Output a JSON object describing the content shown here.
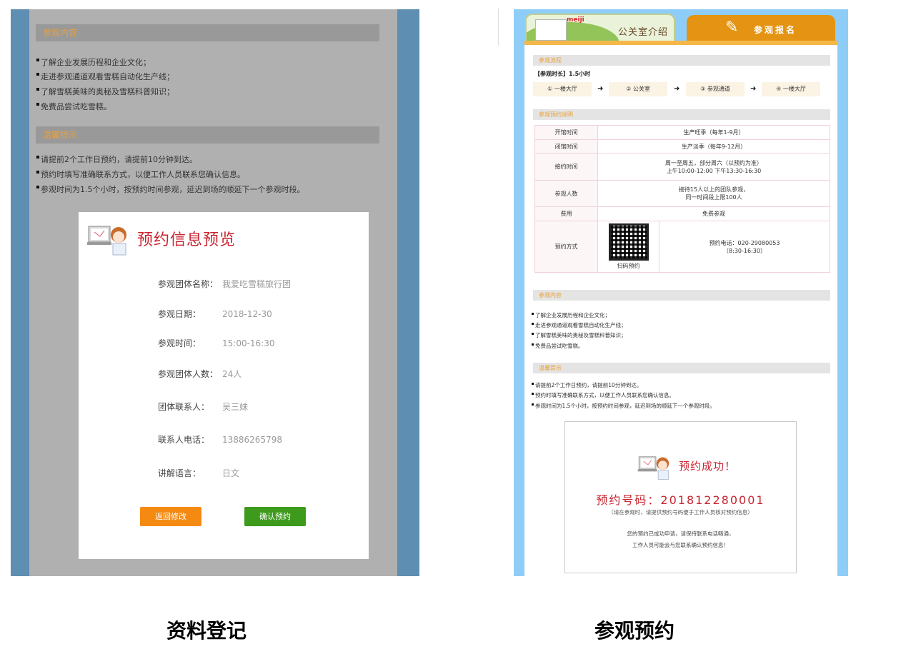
{
  "left": {
    "section_content": "参观内容",
    "content_items": [
      "了解企业发展历程和企业文化；",
      "走进参观通道观看雪糕自动化生产线；",
      "了解雪糕美味的奥秘及雪糕科普知识；",
      "免费品尝试吃雪糕。"
    ],
    "section_tips": "温馨提示",
    "tips_items": [
      "请提前2个工作日预约，请提前10分钟到达。",
      "预约时填写准确联系方式，以便工作人员联系您确认信息。",
      "参观时间为1.5个小时，按预约时间参观，延迟到场的顺延下一个参观时段。"
    ],
    "modal": {
      "title": "预约信息预览",
      "fields": [
        {
          "label": "参观团体名称：",
          "value": "我爱吃雪糕旅行团"
        },
        {
          "label": "参观日期：",
          "value": "2018-12-30"
        },
        {
          "label": "参观时间：",
          "value": "15:00-16:30"
        },
        {
          "label": "参观团体人数：",
          "value": "24人"
        },
        {
          "label": "团体联系人：",
          "value": "吴三妹"
        },
        {
          "label": "联系人电话：",
          "value": "13886265798"
        },
        {
          "label": "讲解语言：",
          "value": "日文"
        }
      ],
      "back_label": "返回修改",
      "confirm_label": "确认预约"
    }
  },
  "right": {
    "tab_intro": "公关室介绍",
    "tab_intro_brand": "meiji",
    "tab_signup": "参观报名",
    "section_flow": "参观流程",
    "duration": "【参观时长】1.5小时",
    "steps": [
      "① 一楼大厅",
      "② 公关室",
      "③ 参观通道",
      "④ 一楼大厅"
    ],
    "section_notes": "参观预约说明",
    "table": [
      {
        "k": "开馆时间",
        "v": "生产旺季（每年1-9月）"
      },
      {
        "k": "闭馆时间",
        "v": "生产淡季（每年9-12月）"
      },
      {
        "k": "接约时间",
        "v": "周一至周五，部分周六（以预约为准）",
        "v2": "上午10:00-12:00  下午13:30-16:30"
      },
      {
        "k": "参观人数",
        "v": "接待15人以上的团队参观，",
        "v2": "同一时间段上限100人"
      },
      {
        "k": "费用",
        "v": "免费参观"
      },
      {
        "k": "预约方式",
        "qr_caption": "扫码预约",
        "v": "预约电话：020-29080053",
        "v2": "（8:30-16:30）"
      }
    ],
    "section_content": "参观内容",
    "content_items": [
      "了解企业发展历程和企业文化；",
      "走进参观通道观看雪糕自动化生产线；",
      "了解雪糕美味的奥秘及雪糕科普知识；",
      "免费品尝试吃雪糕。"
    ],
    "section_tips": "温馨提示",
    "tips_items": [
      "请提前2个工作日预约，请提前10分钟到达。",
      "预约时填写准确联系方式，以便工作人员联系您确认信息。",
      "参观时间为1.5个小时，按预约时间参观，延迟到场的顺延下一个参观时段。"
    ],
    "success": {
      "title": "预约成功！",
      "code": "预约号码：201812280001",
      "hint": "（请在参观时，请提供预约号码便于工作人员核对预约信息）",
      "msg1": "您的预约已成功申请，请保持联系电话畅通，",
      "msg2": "工作人员可能会与您联系确认预约信息！"
    }
  },
  "captions": {
    "left": "资料登记",
    "right": "参观预约"
  }
}
